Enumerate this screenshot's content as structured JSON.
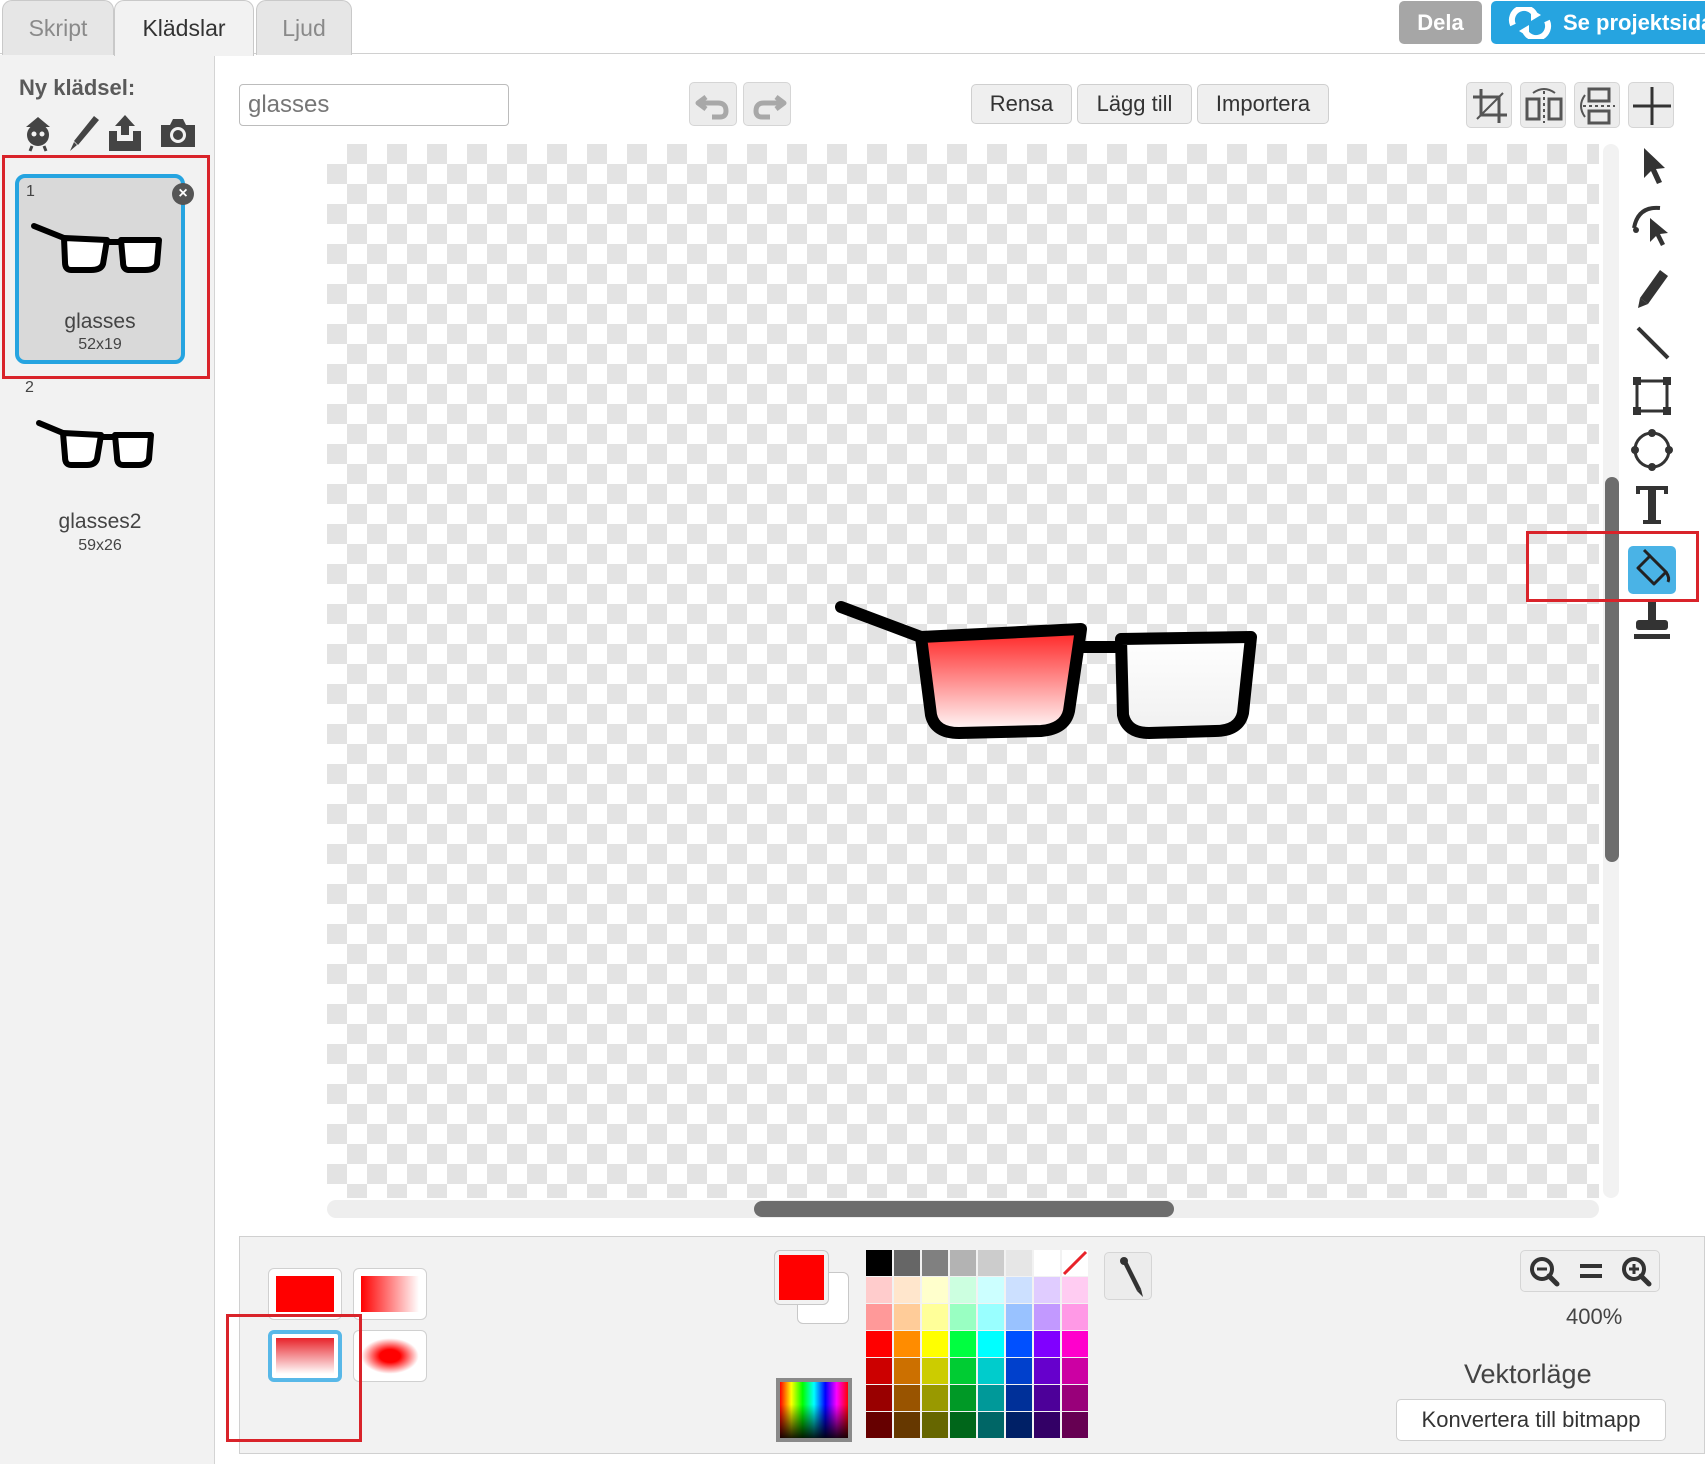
{
  "tabs": [
    {
      "label": "Skript",
      "active": false
    },
    {
      "label": "Klädslar",
      "active": true
    },
    {
      "label": "Ljud",
      "active": false
    }
  ],
  "header": {
    "share_label": "Dela",
    "project_label": "Se projektsida"
  },
  "sidebar": {
    "new_costume_label": "Ny klädsel:",
    "new_costume_icons": [
      "sprite-library-icon",
      "paint-brush-icon",
      "upload-icon",
      "camera-icon"
    ],
    "costumes": [
      {
        "number": "1",
        "name": "glasses",
        "size": "52x19",
        "selected": true
      },
      {
        "number": "2",
        "name": "glasses2",
        "size": "59x26",
        "selected": false
      }
    ]
  },
  "editor": {
    "costume_name_value": "glasses",
    "actions": {
      "clear": "Rensa",
      "add": "Lägg till",
      "import": "Importera"
    },
    "history_icons": [
      "undo-icon",
      "redo-icon"
    ],
    "transform_icons": [
      "crop-icon",
      "flip-horizontal-icon",
      "flip-vertical-icon",
      "set-center-icon"
    ],
    "tools": [
      "select-icon",
      "reshape-icon",
      "pencil-icon",
      "line-icon",
      "rectangle-icon",
      "ellipse-icon",
      "text-icon",
      "color-fill-icon",
      "stamp-icon"
    ],
    "active_tool": "color-fill-icon",
    "zoom_level": "400%",
    "mode_label": "Vektorläge",
    "convert_label": "Konvertera till bitmapp",
    "fill_options": [
      "solid",
      "horizontal-gradient",
      "vertical-gradient",
      "radial-gradient"
    ],
    "active_fill_option": "vertical-gradient",
    "primary_color": "#ff0000",
    "secondary_color": "#ffffff"
  },
  "palette": {
    "rows": [
      [
        "#000000",
        "#666666",
        "#808080",
        "#b3b3b3",
        "#cccccc",
        "#e6e6e6",
        "#ffffff",
        "none"
      ],
      [
        "#ffcccc",
        "#ffe6cc",
        "#ffffcc",
        "#ccffe0",
        "#ccffff",
        "#cce0ff",
        "#e0ccff",
        "#ffccf2"
      ],
      [
        "#ff9999",
        "#ffcc99",
        "#ffff99",
        "#99ffc2",
        "#99ffff",
        "#99c2ff",
        "#c299ff",
        "#ff99e6"
      ],
      [
        "#ff0000",
        "#ff8c00",
        "#ffff00",
        "#00ff40",
        "#00ffff",
        "#0050ff",
        "#8000ff",
        "#ff00cc"
      ],
      [
        "#cc0000",
        "#cc7000",
        "#cccc00",
        "#00cc33",
        "#00cccc",
        "#0040cc",
        "#6600cc",
        "#cc00a3"
      ],
      [
        "#990000",
        "#995400",
        "#999900",
        "#009926",
        "#009999",
        "#003099",
        "#4d0099",
        "#99007a"
      ],
      [
        "#660000",
        "#663800",
        "#666600",
        "#00661a",
        "#006666",
        "#002066",
        "#330066",
        "#660052"
      ]
    ]
  },
  "colors": {
    "accent": "#26a4e0",
    "highlight_box": "#d9232a",
    "active_tool_bg": "#4ab3e6"
  }
}
